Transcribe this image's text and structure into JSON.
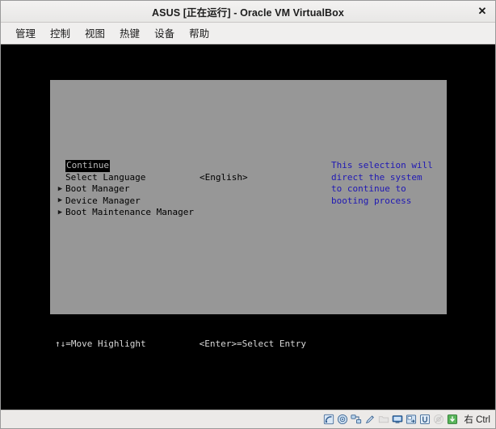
{
  "window": {
    "title": "ASUS [正在运行] - Oracle VM VirtualBox",
    "close_label": "✕"
  },
  "menubar": {
    "items": [
      {
        "label": "管理",
        "name": "menu-manage"
      },
      {
        "label": "控制",
        "name": "menu-control"
      },
      {
        "label": "视图",
        "name": "menu-view"
      },
      {
        "label": "热键",
        "name": "menu-hotkeys"
      },
      {
        "label": "设备",
        "name": "menu-devices"
      },
      {
        "label": "帮助",
        "name": "menu-help"
      }
    ]
  },
  "bios": {
    "menu_items": [
      {
        "label": "Continue",
        "value": "",
        "bullet": "",
        "selected": true
      },
      {
        "label": "Select Language",
        "value": "<English>",
        "bullet": "",
        "selected": false
      },
      {
        "label": "Boot Manager",
        "value": "",
        "bullet": "▶",
        "selected": false
      },
      {
        "label": "Device Manager",
        "value": "",
        "bullet": "▶",
        "selected": false
      },
      {
        "label": "Boot Maintenance Manager",
        "value": "",
        "bullet": "▶",
        "selected": false
      }
    ],
    "help_text": "This selection will direct the system to continue to booting process",
    "hints": {
      "move": "↑↓=Move Highlight",
      "select": "<Enter>=Select Entry"
    },
    "colors": {
      "panel_bg": "#979797",
      "help_text": "#1f18b4",
      "highlight_bg": "#000000",
      "highlight_fg": "#b9b9b9"
    }
  },
  "statusbar": {
    "icons": [
      {
        "name": "hard-disk-icon"
      },
      {
        "name": "optical-disk-icon"
      },
      {
        "name": "network-icon"
      },
      {
        "name": "pencil-icon"
      },
      {
        "name": "folder-icon"
      },
      {
        "name": "display-icon"
      },
      {
        "name": "shared-folders-icon"
      },
      {
        "name": "usb-icon"
      },
      {
        "name": "recording-disabled-icon"
      },
      {
        "name": "mouse-capture-icon"
      }
    ],
    "host_key": "右 Ctrl"
  }
}
